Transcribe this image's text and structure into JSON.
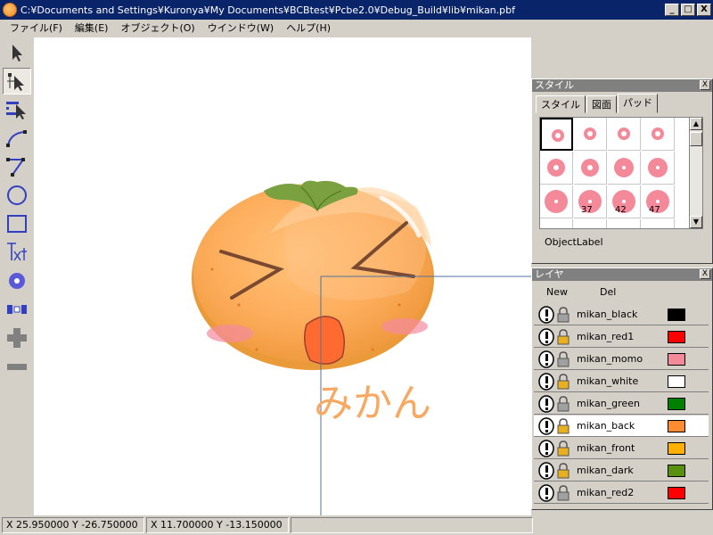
{
  "window": {
    "title": "C:¥Documents and Settings¥Kuronya¥My Documents¥BCBtest¥Pcbe2.0¥Debug_Build¥lib¥mikan.pbf",
    "minimize": "_",
    "maximize": "□",
    "close": "X"
  },
  "menu": [
    "ファイル(F)",
    "編集(E)",
    "オブジェクト(O)",
    "ウインドウ(W)",
    "ヘルプ(H)"
  ],
  "tools": [
    "arrow-tool",
    "node-select-tool",
    "group-select-tool",
    "curve-tool",
    "polyline-tool",
    "circle-tool",
    "rectangle-tool",
    "text-tool",
    "pad-tool",
    "array-tool",
    "add-tool",
    "remove-tool"
  ],
  "canvas": {
    "label_text": "みかん"
  },
  "status": {
    "cursor": "X  25.950000  Y  -26.750000",
    "offset": "X  11.700000  Y  -13.150000",
    "extra": ""
  },
  "style_panel": {
    "title": "スタイル",
    "close": "X",
    "tabs": [
      "スタイル",
      "図面",
      "パッド"
    ],
    "active_tab": 2,
    "pad_cells": [
      {
        "label": ""
      },
      {
        "label": ""
      },
      {
        "label": ""
      },
      {
        "label": ""
      },
      {
        "label": ""
      },
      {
        "label": ""
      },
      {
        "label": ""
      },
      {
        "label": ""
      },
      {
        "label": ""
      },
      {
        "label": "37"
      },
      {
        "label": "42"
      },
      {
        "label": "47"
      },
      {
        "label": ""
      },
      {
        "label": ""
      },
      {
        "label": ""
      },
      {
        "label": ""
      }
    ],
    "object_label": "ObjectLabel",
    "pad_color": "#f4899a"
  },
  "layer_panel": {
    "title": "レイヤ",
    "close": "X",
    "new_label": "New",
    "del_label": "Del",
    "layers": [
      {
        "name": "mikan_black",
        "color": "#000000",
        "locked": false
      },
      {
        "name": "mikan_red1",
        "color": "#ff0000",
        "locked": true
      },
      {
        "name": "mikan_momo",
        "color": "#f4899a",
        "locked": false
      },
      {
        "name": "mikan_white",
        "color": "#ffffff",
        "locked": true
      },
      {
        "name": "mikan_green",
        "color": "#008000",
        "locked": false
      },
      {
        "name": "mikan_back",
        "color": "#ff8c30",
        "locked": true,
        "selected": true
      },
      {
        "name": "mikan_front",
        "color": "#ffb000",
        "locked": true
      },
      {
        "name": "mikan_dark",
        "color": "#5a9010",
        "locked": true
      },
      {
        "name": "mikan_red2",
        "color": "#ff0000",
        "locked": false
      }
    ]
  }
}
